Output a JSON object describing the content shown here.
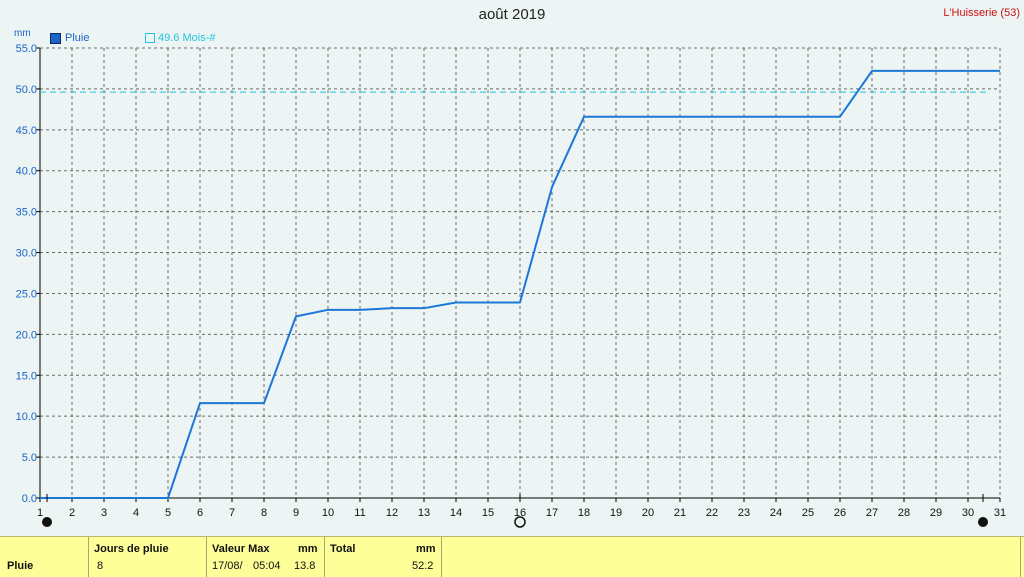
{
  "header": {
    "title": "août 2019",
    "location": "L'Huisserie (53)",
    "unit": "mm"
  },
  "legend": {
    "series_label": "Pluie",
    "reference_label": "49.6 Mois-#"
  },
  "colors": {
    "series": "#1b78d8",
    "reference": "#23c4e0",
    "grid": "#6c6c6c",
    "footer_bg": "#ffff9a"
  },
  "chart_data": {
    "type": "line",
    "x": [
      1,
      2,
      3,
      4,
      5,
      6,
      7,
      8,
      9,
      10,
      11,
      12,
      13,
      14,
      15,
      16,
      17,
      18,
      19,
      20,
      21,
      22,
      23,
      24,
      25,
      26,
      27,
      28,
      29,
      30,
      31
    ],
    "series": [
      {
        "name": "Pluie",
        "values": [
          0,
          0,
          0,
          0,
          0,
          11.6,
          11.6,
          11.6,
          22.2,
          23.0,
          23.0,
          23.2,
          23.2,
          23.9,
          23.9,
          23.9,
          38.0,
          46.6,
          46.6,
          46.6,
          46.6,
          46.6,
          46.6,
          46.6,
          46.6,
          46.6,
          52.2,
          52.2,
          52.2,
          52.2,
          52.2
        ]
      }
    ],
    "reference_line": {
      "label": "49.6 Mois-#",
      "value": 49.6
    },
    "xlim": [
      1,
      31
    ],
    "ylim": [
      0,
      55
    ],
    "y_ticks": [
      "0.0",
      "5.0",
      "10.0",
      "15.0",
      "20.0",
      "25.0",
      "30.0",
      "35.0",
      "40.0",
      "45.0",
      "50.0",
      "55.0"
    ],
    "x_ticks": [
      "1",
      "2",
      "3",
      "4",
      "5",
      "6",
      "7",
      "8",
      "9",
      "10",
      "11",
      "12",
      "13",
      "14",
      "15",
      "16",
      "17",
      "18",
      "19",
      "20",
      "21",
      "22",
      "23",
      "24",
      "25",
      "26",
      "27",
      "28",
      "29",
      "30",
      "31"
    ],
    "grid": true,
    "legend_position": "top-left",
    "moon_phases": [
      {
        "day": 1,
        "phase": "new"
      },
      {
        "day": 16,
        "phase": "full"
      },
      {
        "day": 30,
        "phase": "new"
      }
    ]
  },
  "footer": {
    "row_label": "Pluie",
    "col1_header": "Jours de pluie",
    "col1_value": "8",
    "col2_header": "Valeur Max",
    "col2_unit": "mm",
    "col2_date": "17/08/",
    "col2_time": "05:04",
    "col2_value": "13.8",
    "col3_header": "Total",
    "col3_unit": "mm",
    "col3_value": "52.2"
  }
}
